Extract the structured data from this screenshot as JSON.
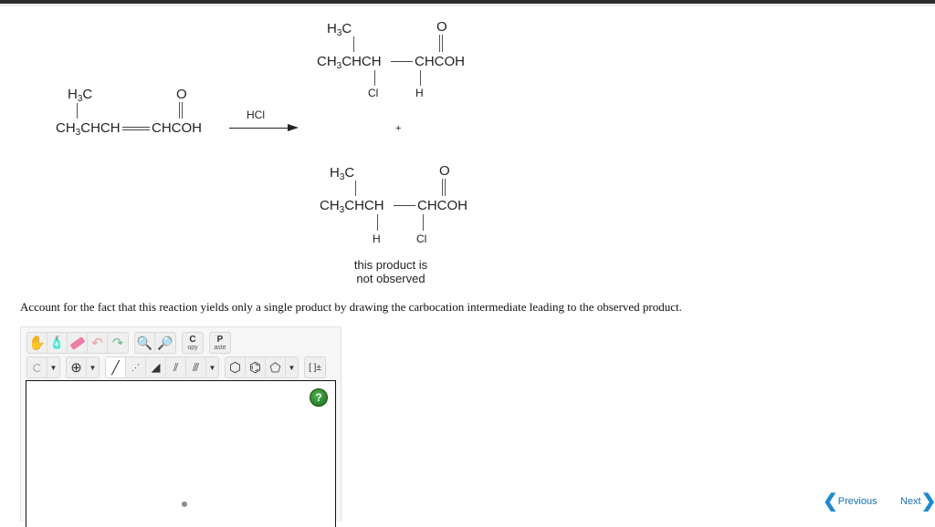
{
  "reaction": {
    "reactant": {
      "top_left": "H3C",
      "top_right": "O",
      "main_chain": [
        "CH3CHCH",
        "CHCOH"
      ],
      "bond_between": "double"
    },
    "reagent": "HCl",
    "plus_sign": "+",
    "product_observed": {
      "top_left": "H3C",
      "top_right": "O",
      "main_chain": [
        "CH3CHCH",
        "CHCOH"
      ],
      "substituent_left": "Cl",
      "substituent_right": "H"
    },
    "product_not_observed": {
      "top_left": "H3C",
      "top_right": "O",
      "main_chain": [
        "CH3CHCH",
        "CHCOH"
      ],
      "substituent_left": "H",
      "substituent_right": "Cl",
      "caption_line1": "this product is",
      "caption_line2": "not observed"
    }
  },
  "question": "Account for the fact that this reaction yields only a single product by drawing the carbocation intermediate leading to the observed product.",
  "editor": {
    "toolbar_row1": [
      {
        "icon": "hand-icon",
        "label": "Move"
      },
      {
        "icon": "clear-bottle-icon",
        "label": "Clear"
      },
      {
        "icon": "eraser-icon",
        "label": "Erase"
      },
      {
        "icon": "undo-icon",
        "label": "Undo"
      },
      {
        "icon": "redo-icon",
        "label": "Redo"
      },
      {
        "icon": "zoom-in-icon",
        "label": "Zoom in"
      },
      {
        "icon": "zoom-out-icon",
        "label": "Zoom out"
      },
      {
        "icon": "copy-icon",
        "label_top": "C",
        "label_bottom": "opy"
      },
      {
        "icon": "paste-icon",
        "label_top": "P",
        "label_bottom": "aste"
      }
    ],
    "atom_selector": "C",
    "charge_symbol": "⊕",
    "bracket_symbol": "[ ]±",
    "help_symbol": "?"
  },
  "navigation": {
    "previous_label": "Previous",
    "next_label": "Next"
  }
}
